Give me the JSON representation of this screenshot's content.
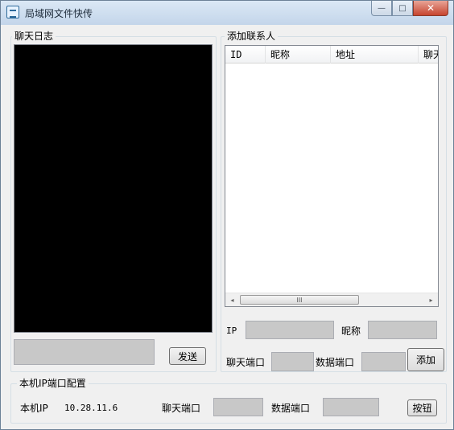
{
  "window": {
    "title": "局域网文件快传",
    "minimize_glyph": "—",
    "maximize_glyph": "□",
    "close_glyph": "✕"
  },
  "chat_log": {
    "group_label": "聊天日志",
    "send_label": "发送"
  },
  "contacts": {
    "group_label": "添加联系人",
    "columns": [
      "ID",
      "昵称",
      "地址",
      "聊天"
    ],
    "ip_label": "IP",
    "nickname_label": "昵称",
    "chat_port_label": "聊天端口",
    "data_port_label": "数据端口",
    "add_label": "添加",
    "scroll_left_glyph": "◂",
    "scroll_right_glyph": "▸",
    "scroll_grip_glyph": "III"
  },
  "local_config": {
    "group_label": "本机IP端口配置",
    "local_ip_label": "本机IP",
    "local_ip_value": "10.28.11.6",
    "chat_port_label": "聊天端口",
    "data_port_label": "数据端口",
    "button_label": "按钮"
  }
}
